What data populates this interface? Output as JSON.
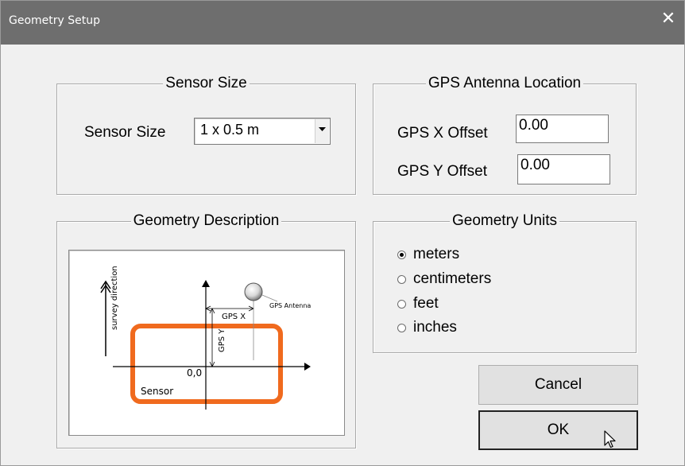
{
  "window": {
    "title": "Geometry Setup",
    "close_glyph": "✕"
  },
  "sensor_group": {
    "legend": "Sensor Size",
    "label": "Sensor Size",
    "selected": "1 x 0.5 m"
  },
  "gps_group": {
    "legend": "GPS Antenna Location",
    "x_label": "GPS X Offset",
    "x_value": "0.00",
    "y_label": "GPS Y Offset",
    "y_value": "0.00"
  },
  "description_group": {
    "legend": "Geometry Description",
    "diagram": {
      "survey_direction": "survey direction",
      "gps_x": "GPS X",
      "gps_y": "GPS Y",
      "gps_antenna": "GPS Antenna",
      "origin": "0,0",
      "sensor": "Sensor",
      "sensor_color": "#f06a1e"
    }
  },
  "units_group": {
    "legend": "Geometry Units",
    "options": [
      "meters",
      "centimeters",
      "feet",
      "inches"
    ],
    "selected": "meters"
  },
  "buttons": {
    "cancel": "Cancel",
    "ok": "OK"
  }
}
